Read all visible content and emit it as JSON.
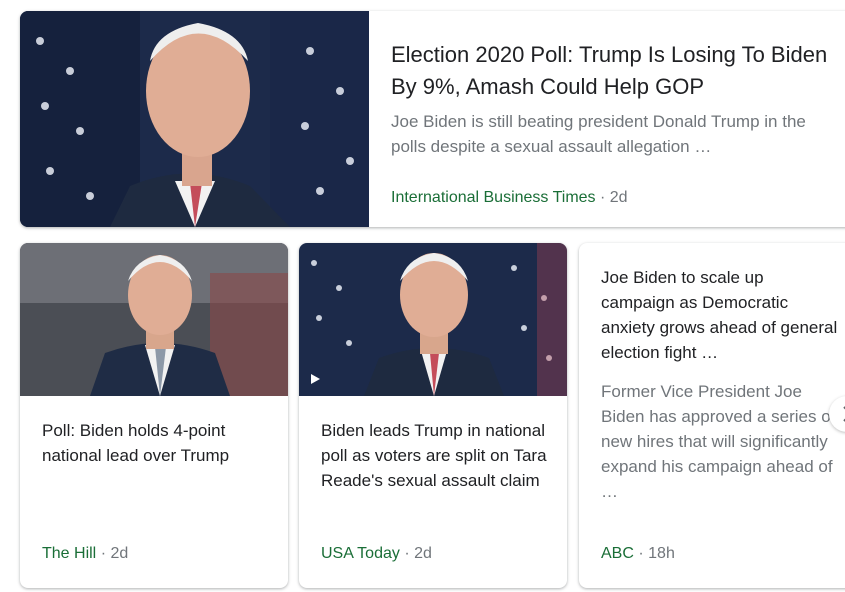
{
  "top_story": {
    "title": "Election 2020 Poll: Trump Is Losing To Biden By 9%, Amash Could Help GOP",
    "snippet": "Joe Biden is still beating president Donald Trump in the polls despite a sexual assault allegation …",
    "source": "International Business Times",
    "separator": "·",
    "age": "2d"
  },
  "cards": [
    {
      "title": "Poll: Biden holds 4-point national lead over Trump",
      "source": "The Hill",
      "separator": "·",
      "age": "2d"
    },
    {
      "title": "Biden leads Trump in national poll as voters are split on Tara Reade's sexual assault claim",
      "source": "USA Today",
      "separator": "·",
      "age": "2d",
      "media_icon": "play-icon"
    },
    {
      "title": "Joe Biden to scale up campaign as Democratic anxiety grows ahead of general election fight …",
      "snippet": "Former Vice President Joe Biden has approved a series of new hires that will significantly expand his campaign ahead of …",
      "source": "ABC",
      "separator": "·",
      "age": "18h"
    }
  ],
  "colors": {
    "title": "#202124",
    "snippet": "#70757a",
    "source": "#1a6e37"
  }
}
